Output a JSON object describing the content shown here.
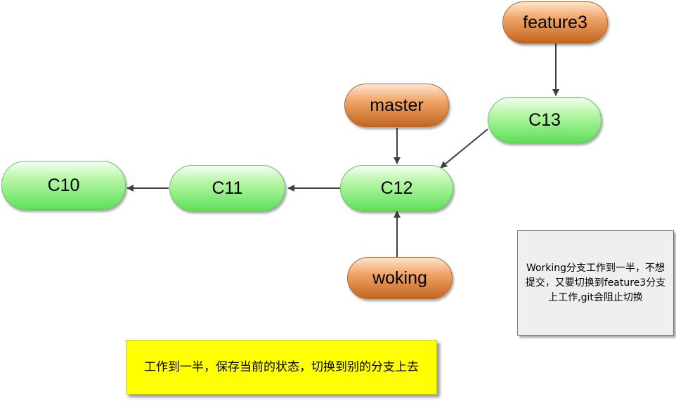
{
  "commits": {
    "c10": "C10",
    "c11": "C11",
    "c12": "C12",
    "c13": "C13"
  },
  "branches": {
    "master": "master",
    "feature3": "feature3",
    "woking": "woking"
  },
  "note": "Working分支工作到一半，不想提交，又要切换到feature3分支上工作,git会阻止切换",
  "sticky": "工作到一半，保存当前的状态，切换到别的分支上去",
  "colors": {
    "commit_fill": "#5ee05a",
    "branch_fill": "#c2661f",
    "note_fill": "#efefef",
    "sticky_fill": "#ffff00",
    "arrow": "#404040"
  }
}
